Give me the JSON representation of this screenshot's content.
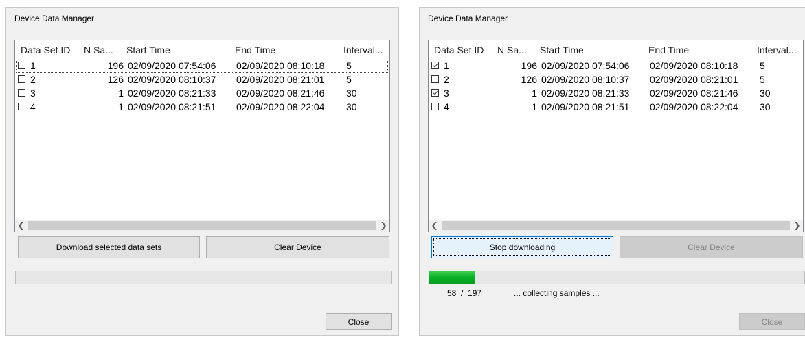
{
  "colors": {
    "window_bg": "#f0f0f0",
    "list_bg": "#ffffff",
    "progress_green": "#06b025",
    "button_focus_border": "#0078d7",
    "disabled_text": "#838383"
  },
  "left": {
    "title": "Device Data Manager",
    "columns": [
      "Data Set ID",
      "N Sa...",
      "Start Time",
      "End Time",
      "Interval..."
    ],
    "rows": [
      {
        "id": "1",
        "n": "196",
        "start": "02/09/2020 07:54:06",
        "end": "02/09/2020 08:10:18",
        "interval": "5"
      },
      {
        "id": "2",
        "n": "126",
        "start": "02/09/2020 08:10:37",
        "end": "02/09/2020 08:21:01",
        "interval": "5"
      },
      {
        "id": "3",
        "n": "1",
        "start": "02/09/2020 08:21:33",
        "end": "02/09/2020 08:21:46",
        "interval": "30"
      },
      {
        "id": "4",
        "n": "1",
        "start": "02/09/2020 08:21:51",
        "end": "02/09/2020 08:22:04",
        "interval": "30"
      }
    ],
    "checked": [
      false,
      false,
      false,
      false
    ],
    "buttons": {
      "download": "Download selected data sets",
      "clear": "Clear Device",
      "close": "Close"
    },
    "progress_fraction": 0
  },
  "right": {
    "title": "Device Data Manager",
    "columns": [
      "Data Set ID",
      "N Sa...",
      "Start Time",
      "End Time",
      "Interval..."
    ],
    "rows": [
      {
        "id": "1",
        "n": "196",
        "start": "02/09/2020 07:54:06",
        "end": "02/09/2020 08:10:18",
        "interval": "5"
      },
      {
        "id": "2",
        "n": "126",
        "start": "02/09/2020 08:10:37",
        "end": "02/09/2020 08:21:01",
        "interval": "5"
      },
      {
        "id": "3",
        "n": "1",
        "start": "02/09/2020 08:21:33",
        "end": "02/09/2020 08:21:46",
        "interval": "30"
      },
      {
        "id": "4",
        "n": "1",
        "start": "02/09/2020 08:21:51",
        "end": "02/09/2020 08:22:04",
        "interval": "30"
      }
    ],
    "checked": [
      true,
      false,
      true,
      false
    ],
    "buttons": {
      "stop": "Stop downloading",
      "clear": "Clear Device",
      "close": "Close"
    },
    "progress_fraction": 0.12,
    "status": {
      "count": "58  /  197",
      "message": "... collecting samples ..."
    }
  }
}
